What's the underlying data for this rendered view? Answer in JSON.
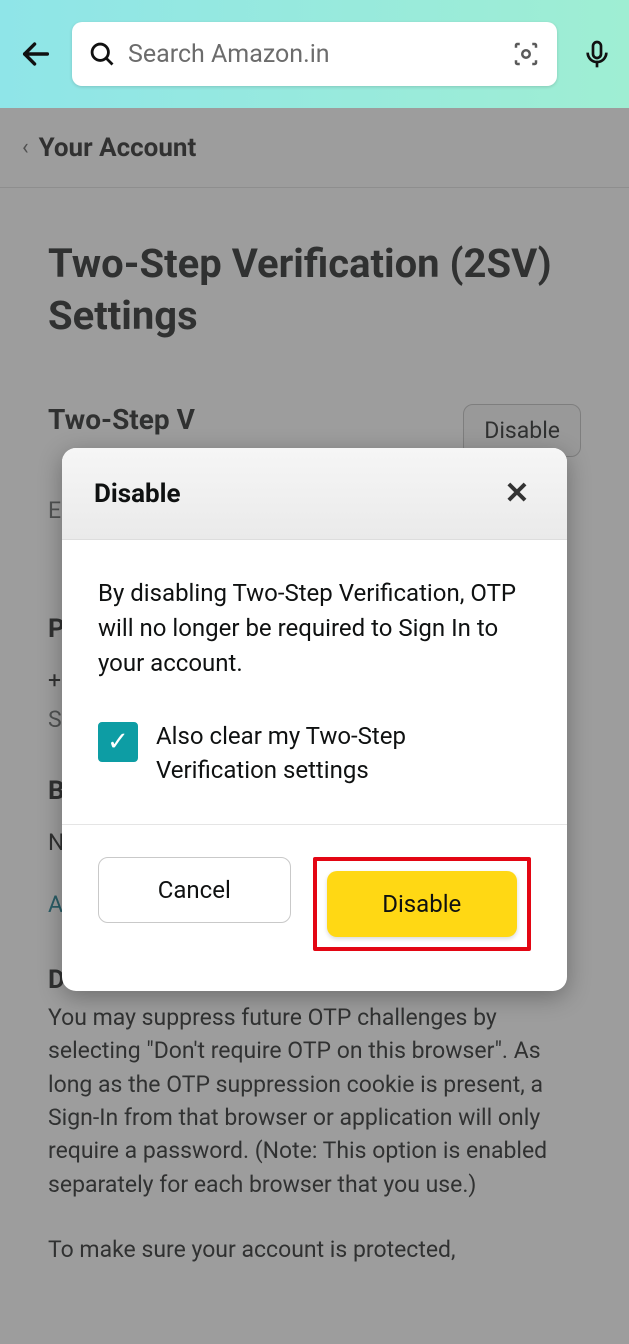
{
  "header": {
    "search_placeholder": "Search Amazon.in"
  },
  "breadcrumb": {
    "label": "Your Account"
  },
  "page": {
    "title": "Two-Step Verification (2SV) Settings",
    "sub_heading": "Two-Step V",
    "sub_e": "E",
    "disable_pill": "Disable",
    "p_label": "P",
    "plus": "+",
    "s_label": "S",
    "b_label": "B",
    "n_label": "N",
    "a_label": "A",
    "d_label": "D",
    "paragraph1": "You may suppress future OTP challenges by selecting \"Don't require OTP on this browser\". As long as the OTP suppression cookie is present, a Sign-In from that browser or application will only require a password. (Note: This option is enabled separately for each browser that you use.)",
    "paragraph2": "To make sure your account is protected,"
  },
  "modal": {
    "title": "Disable",
    "body": "By disabling Two-Step Verification, OTP will no longer be required to Sign In to your account.",
    "checkbox_label": "Also clear my Two-Step Verification settings",
    "cancel": "Cancel",
    "disable": "Disable"
  }
}
